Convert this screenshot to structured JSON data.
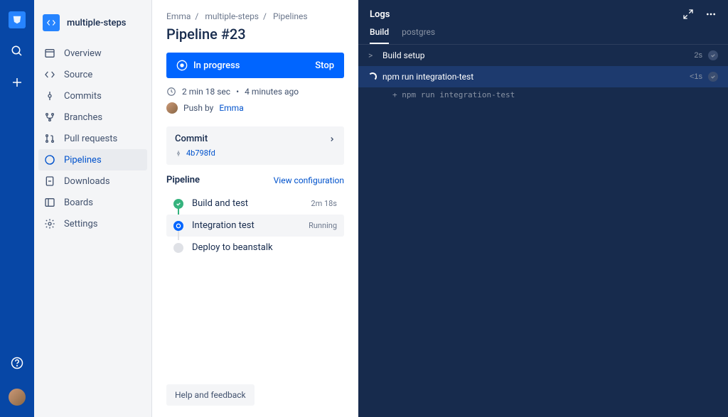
{
  "rail": {
    "logo": "bucket"
  },
  "project": {
    "name": "multiple-steps"
  },
  "nav": {
    "items": [
      {
        "icon": "overview",
        "label": "Overview"
      },
      {
        "icon": "source",
        "label": "Source"
      },
      {
        "icon": "commits",
        "label": "Commits"
      },
      {
        "icon": "branches",
        "label": "Branches"
      },
      {
        "icon": "pullrequests",
        "label": "Pull requests"
      },
      {
        "icon": "pipelines",
        "label": "Pipelines"
      },
      {
        "icon": "downloads",
        "label": "Downloads"
      },
      {
        "icon": "boards",
        "label": "Boards"
      },
      {
        "icon": "settings",
        "label": "Settings"
      }
    ],
    "active_index": 5
  },
  "breadcrumbs": [
    "Emma",
    "multiple-steps",
    "Pipelines"
  ],
  "page_title": "Pipeline #23",
  "status": {
    "label": "In progress",
    "action": "Stop"
  },
  "meta": {
    "duration": "2 min 18 sec",
    "ago": "4 minutes ago",
    "push_prefix": "Push by",
    "author": "Emma"
  },
  "commit": {
    "header": "Commit",
    "hash": "4b798fd"
  },
  "pipeline": {
    "header": "Pipeline",
    "config_link": "View configuration",
    "steps": [
      {
        "name": "Build and test",
        "status": "success",
        "time": "2m 18s"
      },
      {
        "name": "Integration test",
        "status": "running",
        "time": "Running"
      },
      {
        "name": "Deploy to beanstalk",
        "status": "pending",
        "time": ""
      }
    ]
  },
  "help_label": "Help and feedback",
  "logs": {
    "title": "Logs",
    "tabs": [
      "Build",
      "postgres"
    ],
    "active_tab": 0,
    "rows": [
      {
        "type": "collapsed",
        "cmd": "Build setup",
        "time": "2s"
      },
      {
        "type": "running",
        "cmd": "npm run integration-test",
        "time": "<1s"
      }
    ],
    "sub": " + npm run integration-test"
  }
}
